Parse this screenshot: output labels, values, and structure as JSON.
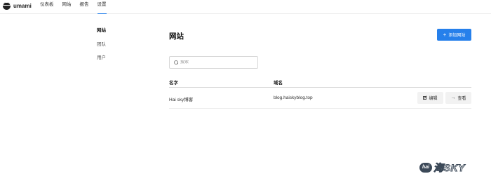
{
  "brand": {
    "name": "umami",
    "logo_icon": "umami-logo-icon"
  },
  "nav": {
    "items": [
      {
        "label": "仪表板",
        "active": false
      },
      {
        "label": "网站",
        "active": false
      },
      {
        "label": "报告",
        "active": false
      },
      {
        "label": "设置",
        "active": true
      }
    ]
  },
  "sidebar": {
    "items": [
      {
        "label": "网站",
        "active": true
      },
      {
        "label": "团队",
        "active": false
      },
      {
        "label": "用户",
        "active": false
      }
    ]
  },
  "main": {
    "title": "网站",
    "add_button": {
      "label": "添加网站",
      "icon": "plus-icon"
    },
    "search": {
      "placeholder": "搜索",
      "value": ""
    },
    "table": {
      "columns": [
        "名字",
        "域名"
      ],
      "rows": [
        {
          "name": "Hai sky博客",
          "domain": "blog.haiskyblog.top",
          "edit_label": "编辑",
          "view_label": "查看"
        }
      ]
    }
  },
  "watermark": {
    "badge": "hai",
    "text": "海SKY"
  },
  "colors": {
    "accent": "#2680eb",
    "button_bg": "#f2f2f2",
    "divider": "#ececec"
  }
}
